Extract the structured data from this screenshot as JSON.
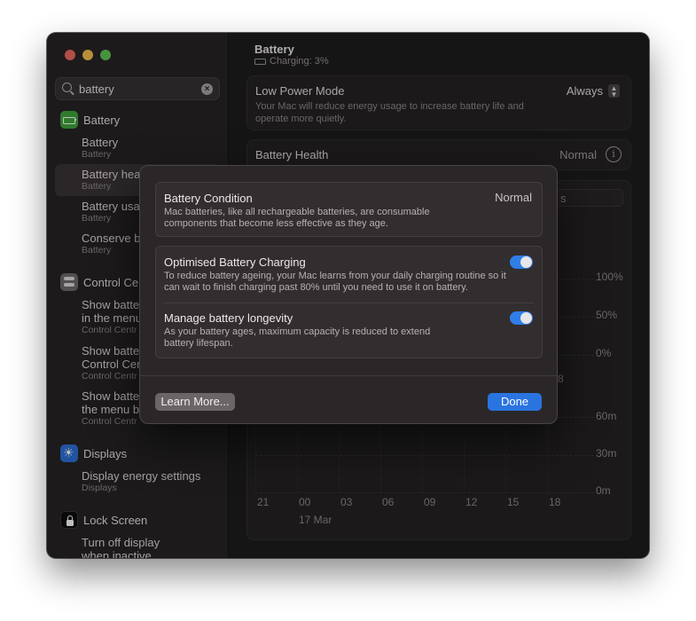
{
  "window": {
    "lights": [
      "close",
      "minimize",
      "zoom"
    ]
  },
  "search": {
    "query": "battery",
    "clear_icon": "clear-icon"
  },
  "sidebar": {
    "groups": [
      {
        "title": "Battery",
        "icon": "battery-icon",
        "items": [
          {
            "title": "Battery",
            "sub": "Battery"
          },
          {
            "title": "Battery hea",
            "sub": "Battery"
          },
          {
            "title": "Battery usa",
            "sub": "Battery"
          },
          {
            "title": "Conserve b",
            "sub": "Battery"
          }
        ]
      },
      {
        "title": "Control Cen",
        "icon": "control-centre-icon",
        "items": [
          {
            "title": "Show batte",
            "title2": "in the menu",
            "sub": "Control Centr"
          },
          {
            "title": "Show batte",
            "title2": "Control Cen",
            "sub": "Control Centr"
          },
          {
            "title": "Show batte",
            "title2": "the menu b",
            "sub": "Control Centr"
          }
        ]
      },
      {
        "title": "Displays",
        "icon": "displays-icon",
        "items": [
          {
            "title": "Display energy settings",
            "sub": "Displays"
          }
        ]
      },
      {
        "title": "Lock Screen",
        "icon": "lock-icon",
        "items": [
          {
            "title": "Turn off display",
            "title2": "when inactive"
          }
        ]
      }
    ]
  },
  "main": {
    "title": "Battery",
    "status": "Charging: 3%",
    "low_power": {
      "title": "Low Power Mode",
      "desc": "Your Mac will reduce energy usage to increase battery life and operate more quietly.",
      "value": "Always"
    },
    "health": {
      "title": "Battery Health",
      "value": "Normal"
    },
    "tab_fragment": "s",
    "level_axis": [
      "100%",
      "50%",
      "0%"
    ],
    "usage_axis": [
      "60m",
      "30m",
      "0m"
    ],
    "x_ticks": [
      "21",
      "00",
      "03",
      "06",
      "09",
      "12",
      "15",
      "18"
    ],
    "x_date": "17 Mar",
    "partial_tick": "8"
  },
  "dialog": {
    "condition": {
      "title": "Battery Condition",
      "value": "Normal",
      "desc": "Mac batteries, like all rechargeable batteries, are consumable components that become less effective as they age."
    },
    "optimised": {
      "title": "Optimised Battery Charging",
      "desc": "To reduce battery ageing, your Mac learns from your daily charging routine so it can wait to finish charging past 80% until you need to use it on battery.",
      "enabled": true
    },
    "longevity": {
      "title": "Manage battery longevity",
      "desc": "As your battery ages, maximum capacity is reduced to extend battery lifespan.",
      "enabled": true
    },
    "learn_more": "Learn More...",
    "done": "Done"
  },
  "colors": {
    "accent": "#2a74e0",
    "toggle_on": "#2f7ee8"
  }
}
